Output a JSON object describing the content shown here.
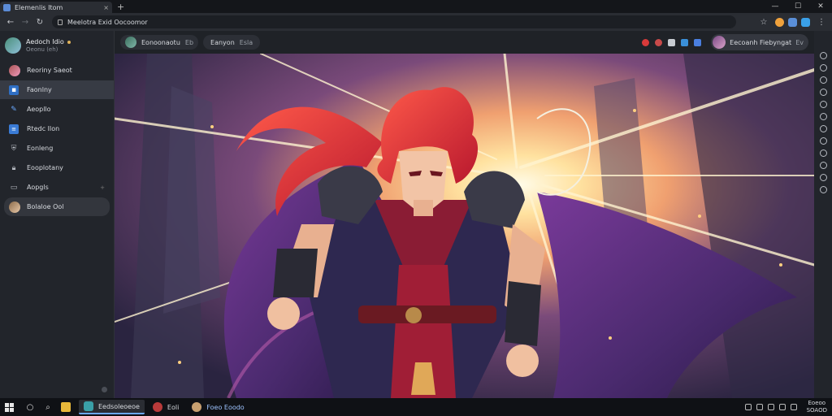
{
  "browser": {
    "tab_title": "Elemenlis Itom",
    "tab_close": "×",
    "new_tab": "+",
    "url": "Meelotra Exid Oocoomor",
    "window": {
      "minimize": "—",
      "maximize": "☐",
      "close": "✕"
    }
  },
  "sidebar": {
    "profile": {
      "name": "Aedoch Idio",
      "status": "Oeonu (eh)"
    },
    "items": [
      {
        "label": "Reoriny Saeot",
        "icon": "avatar"
      },
      {
        "label": "Faonlny",
        "icon": "app-icon",
        "active": true
      },
      {
        "label": "Aeopllo",
        "icon": "pen-icon"
      },
      {
        "label": "Rtedc Ilon",
        "icon": "document-icon"
      },
      {
        "label": "Eonleng",
        "icon": "shield-icon"
      },
      {
        "label": "Eooplotany",
        "icon": "lock-icon"
      },
      {
        "label": "Aopgls",
        "icon": "window-icon",
        "trail": "+"
      },
      {
        "label": "Bolaloe Ool",
        "icon": "avatar",
        "selected": true
      }
    ]
  },
  "chat": {
    "channel": "Eonoonaotu",
    "channel_count": "Eb",
    "tab2": "Eanyon",
    "tab2_sub": "Esla",
    "user_name": "Eecoanh Fiebyngat",
    "user_suffix": "Ev"
  },
  "taskbar": {
    "apps": [
      {
        "label": "Eedsoleoeoe",
        "active": true
      },
      {
        "label": "Eoli",
        "active": false
      },
      {
        "label": "Foeo Eoodo",
        "active": false
      }
    ],
    "clock_time": "Eoeoo",
    "clock_date": "SOAOD"
  },
  "colors": {
    "accent": "#6aa9ff",
    "sidebar_bg": "#22252b",
    "titlebar_bg": "#14161a",
    "hero_red": "#d8253a",
    "hero_purple": "#4a2a6e"
  }
}
